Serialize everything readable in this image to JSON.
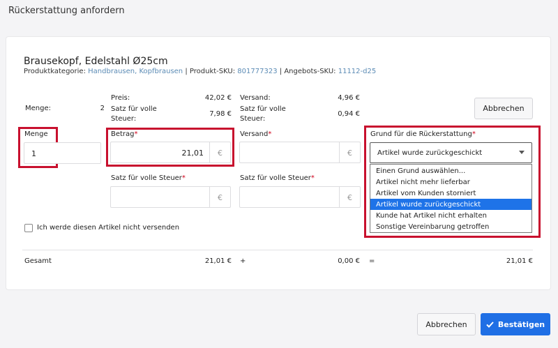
{
  "dialog_title": "Rückerstattung anfordern",
  "product": {
    "name": "Brausekopf, Edelstahl Ø25cm",
    "category_label": "Produktkategorie:",
    "category_value": "Handbrausen, Kopfbrausen",
    "sep1": "|",
    "sku_label": "Produkt-SKU:",
    "sku_value": "801777323",
    "sep2": "|",
    "offer_sku_label": "Angebots-SKU:",
    "offer_sku_value": "11112-d25"
  },
  "summary": {
    "menge_label": "Menge:",
    "menge_value": "2",
    "preis_label": "Preis:",
    "preis_value": "42,02 €",
    "satz_label_1": "Satz für volle",
    "satz_label_2": "Steuer:",
    "satz_value": "7,98 €",
    "versand_label": "Versand:",
    "versand_value": "4,96 €",
    "versand_satz_label_1": "Satz für volle",
    "versand_satz_label_2": "Steuer:",
    "versand_satz_value": "0,94 €"
  },
  "cancel_top": "Abbrechen",
  "form": {
    "menge_label": "Menge",
    "menge_value": "1",
    "betrag_label": "Betrag",
    "betrag_value": "21,01",
    "versand_label": "Versand",
    "versand_value": "",
    "required_mark": "*",
    "currency": "€",
    "tax_label_1": "Satz für volle Steuer",
    "tax_label_2": "Satz für volle Steuer",
    "reason_label": "Grund für die Rückerstattung",
    "reason_selected": "Artikel wurde zurückgeschickt",
    "reason_options": [
      "Einen Grund auswählen...",
      "Artikel nicht mehr lieferbar",
      "Artikel vom Kunden storniert",
      "Artikel wurde zurückgeschickt",
      "Kunde hat Artikel nicht erhalten",
      "Sonstige Vereinbarung getroffen"
    ],
    "reason_active_index": 3,
    "no_ship_label": "Ich werde diesen Artikel nicht versenden"
  },
  "totals": {
    "label": "Gesamt",
    "amount": "21,01 €",
    "plus": "+",
    "shipping": "0,00 €",
    "equals": "=",
    "total": "21,01 €"
  },
  "footer": {
    "cancel": "Abbrechen",
    "confirm": "Bestätigen"
  },
  "colors": {
    "highlight_red": "#c8102e",
    "primary_blue": "#1f6fe5",
    "link_blue": "#5b8bb5",
    "required_red": "#d0021b"
  }
}
